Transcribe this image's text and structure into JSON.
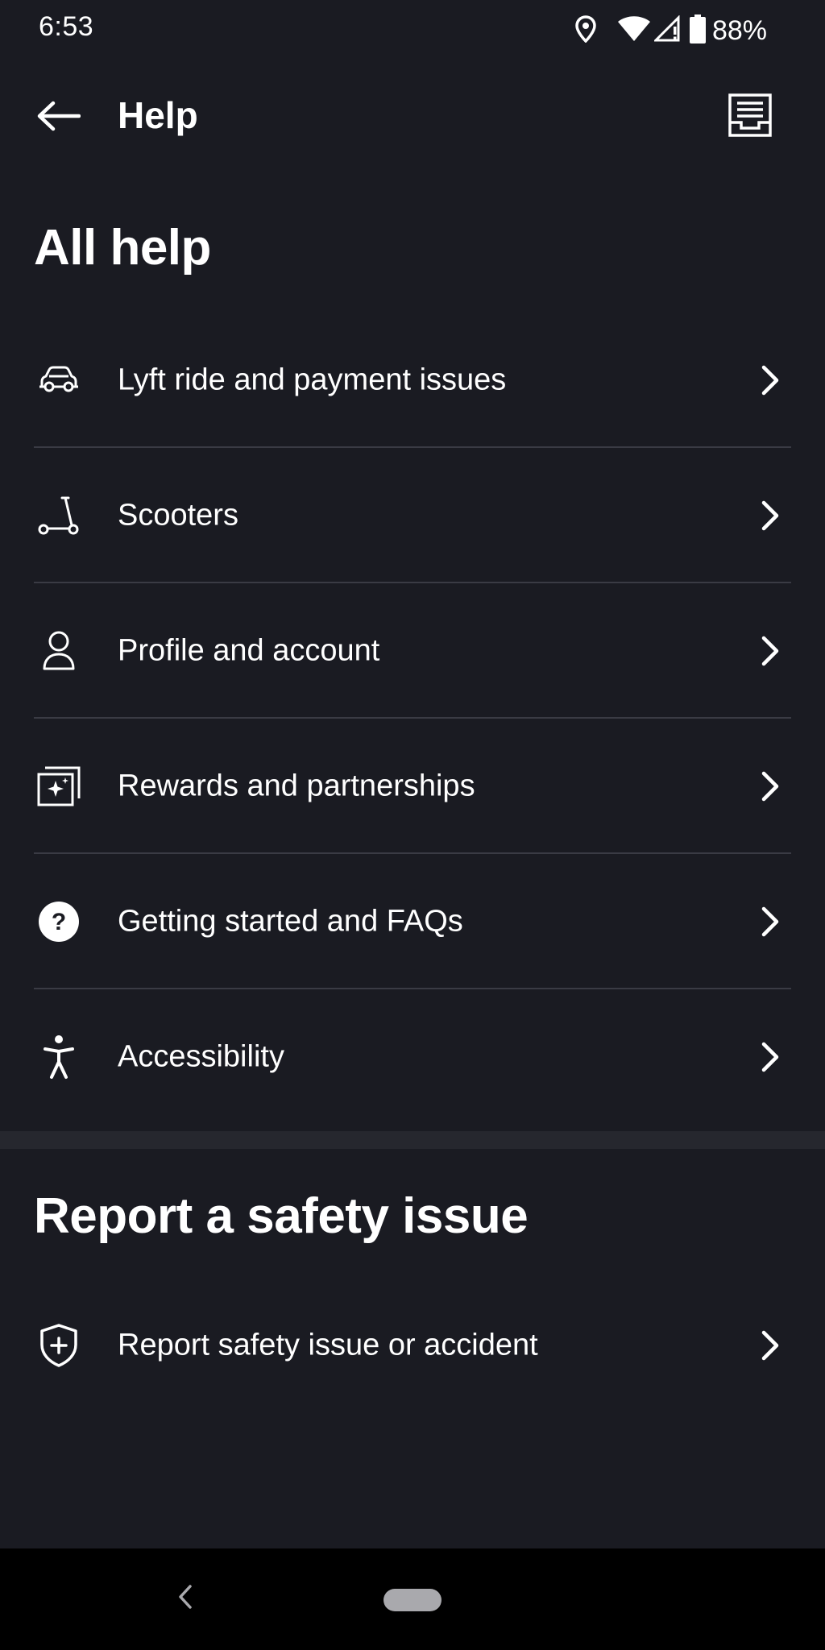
{
  "status_bar": {
    "time": "6:53",
    "battery": "88%",
    "icons": [
      "location-icon",
      "wifi-icon",
      "signal-icon",
      "battery-icon"
    ]
  },
  "app_bar": {
    "title": "Help",
    "back_icon": "arrow-left-icon",
    "inbox_icon": "inbox-icon"
  },
  "all_help": {
    "heading": "All help",
    "items": [
      {
        "label": "Lyft ride and payment issues",
        "icon": "car-icon"
      },
      {
        "label": "Scooters",
        "icon": "scooter-icon"
      },
      {
        "label": "Profile and account",
        "icon": "person-icon"
      },
      {
        "label": "Rewards and partnerships",
        "icon": "rewards-icon"
      },
      {
        "label": "Getting started and FAQs",
        "icon": "question-icon"
      },
      {
        "label": "Accessibility",
        "icon": "accessibility-icon"
      }
    ]
  },
  "safety": {
    "heading": "Report a safety issue",
    "items": [
      {
        "label": "Report safety issue or accident",
        "icon": "shield-plus-icon"
      }
    ]
  },
  "colors": {
    "background": "#1a1b22",
    "divider": "#3a3b44",
    "section_separator": "#26272e",
    "text": "#ffffff",
    "nav_bar": "#000000"
  }
}
